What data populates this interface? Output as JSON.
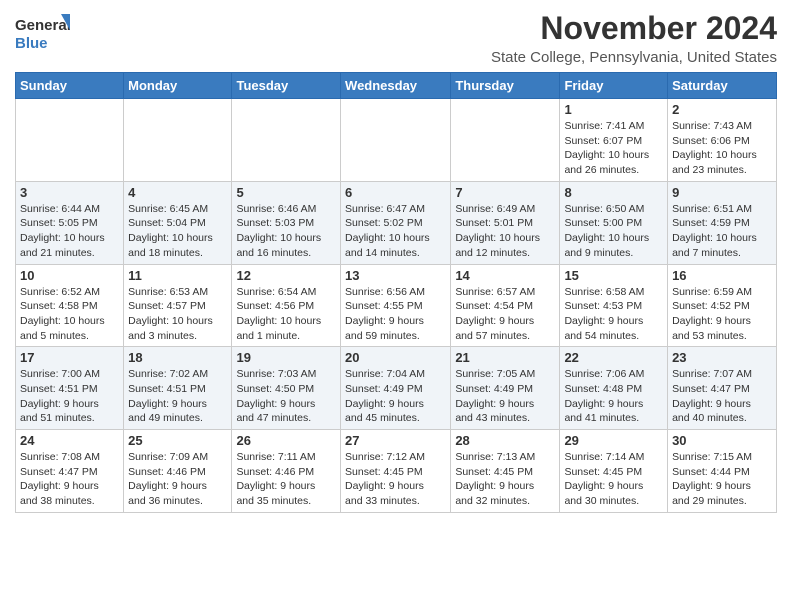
{
  "header": {
    "logo_line1": "General",
    "logo_line2": "Blue",
    "month_title": "November 2024",
    "location": "State College, Pennsylvania, United States"
  },
  "weekdays": [
    "Sunday",
    "Monday",
    "Tuesday",
    "Wednesday",
    "Thursday",
    "Friday",
    "Saturday"
  ],
  "weeks": [
    [
      {
        "day": "",
        "info": ""
      },
      {
        "day": "",
        "info": ""
      },
      {
        "day": "",
        "info": ""
      },
      {
        "day": "",
        "info": ""
      },
      {
        "day": "",
        "info": ""
      },
      {
        "day": "1",
        "info": "Sunrise: 7:41 AM\nSunset: 6:07 PM\nDaylight: 10 hours\nand 26 minutes."
      },
      {
        "day": "2",
        "info": "Sunrise: 7:43 AM\nSunset: 6:06 PM\nDaylight: 10 hours\nand 23 minutes."
      }
    ],
    [
      {
        "day": "3",
        "info": "Sunrise: 6:44 AM\nSunset: 5:05 PM\nDaylight: 10 hours\nand 21 minutes."
      },
      {
        "day": "4",
        "info": "Sunrise: 6:45 AM\nSunset: 5:04 PM\nDaylight: 10 hours\nand 18 minutes."
      },
      {
        "day": "5",
        "info": "Sunrise: 6:46 AM\nSunset: 5:03 PM\nDaylight: 10 hours\nand 16 minutes."
      },
      {
        "day": "6",
        "info": "Sunrise: 6:47 AM\nSunset: 5:02 PM\nDaylight: 10 hours\nand 14 minutes."
      },
      {
        "day": "7",
        "info": "Sunrise: 6:49 AM\nSunset: 5:01 PM\nDaylight: 10 hours\nand 12 minutes."
      },
      {
        "day": "8",
        "info": "Sunrise: 6:50 AM\nSunset: 5:00 PM\nDaylight: 10 hours\nand 9 minutes."
      },
      {
        "day": "9",
        "info": "Sunrise: 6:51 AM\nSunset: 4:59 PM\nDaylight: 10 hours\nand 7 minutes."
      }
    ],
    [
      {
        "day": "10",
        "info": "Sunrise: 6:52 AM\nSunset: 4:58 PM\nDaylight: 10 hours\nand 5 minutes."
      },
      {
        "day": "11",
        "info": "Sunrise: 6:53 AM\nSunset: 4:57 PM\nDaylight: 10 hours\nand 3 minutes."
      },
      {
        "day": "12",
        "info": "Sunrise: 6:54 AM\nSunset: 4:56 PM\nDaylight: 10 hours\nand 1 minute."
      },
      {
        "day": "13",
        "info": "Sunrise: 6:56 AM\nSunset: 4:55 PM\nDaylight: 9 hours\nand 59 minutes."
      },
      {
        "day": "14",
        "info": "Sunrise: 6:57 AM\nSunset: 4:54 PM\nDaylight: 9 hours\nand 57 minutes."
      },
      {
        "day": "15",
        "info": "Sunrise: 6:58 AM\nSunset: 4:53 PM\nDaylight: 9 hours\nand 54 minutes."
      },
      {
        "day": "16",
        "info": "Sunrise: 6:59 AM\nSunset: 4:52 PM\nDaylight: 9 hours\nand 53 minutes."
      }
    ],
    [
      {
        "day": "17",
        "info": "Sunrise: 7:00 AM\nSunset: 4:51 PM\nDaylight: 9 hours\nand 51 minutes."
      },
      {
        "day": "18",
        "info": "Sunrise: 7:02 AM\nSunset: 4:51 PM\nDaylight: 9 hours\nand 49 minutes."
      },
      {
        "day": "19",
        "info": "Sunrise: 7:03 AM\nSunset: 4:50 PM\nDaylight: 9 hours\nand 47 minutes."
      },
      {
        "day": "20",
        "info": "Sunrise: 7:04 AM\nSunset: 4:49 PM\nDaylight: 9 hours\nand 45 minutes."
      },
      {
        "day": "21",
        "info": "Sunrise: 7:05 AM\nSunset: 4:49 PM\nDaylight: 9 hours\nand 43 minutes."
      },
      {
        "day": "22",
        "info": "Sunrise: 7:06 AM\nSunset: 4:48 PM\nDaylight: 9 hours\nand 41 minutes."
      },
      {
        "day": "23",
        "info": "Sunrise: 7:07 AM\nSunset: 4:47 PM\nDaylight: 9 hours\nand 40 minutes."
      }
    ],
    [
      {
        "day": "24",
        "info": "Sunrise: 7:08 AM\nSunset: 4:47 PM\nDaylight: 9 hours\nand 38 minutes."
      },
      {
        "day": "25",
        "info": "Sunrise: 7:09 AM\nSunset: 4:46 PM\nDaylight: 9 hours\nand 36 minutes."
      },
      {
        "day": "26",
        "info": "Sunrise: 7:11 AM\nSunset: 4:46 PM\nDaylight: 9 hours\nand 35 minutes."
      },
      {
        "day": "27",
        "info": "Sunrise: 7:12 AM\nSunset: 4:45 PM\nDaylight: 9 hours\nand 33 minutes."
      },
      {
        "day": "28",
        "info": "Sunrise: 7:13 AM\nSunset: 4:45 PM\nDaylight: 9 hours\nand 32 minutes."
      },
      {
        "day": "29",
        "info": "Sunrise: 7:14 AM\nSunset: 4:45 PM\nDaylight: 9 hours\nand 30 minutes."
      },
      {
        "day": "30",
        "info": "Sunrise: 7:15 AM\nSunset: 4:44 PM\nDaylight: 9 hours\nand 29 minutes."
      }
    ]
  ]
}
